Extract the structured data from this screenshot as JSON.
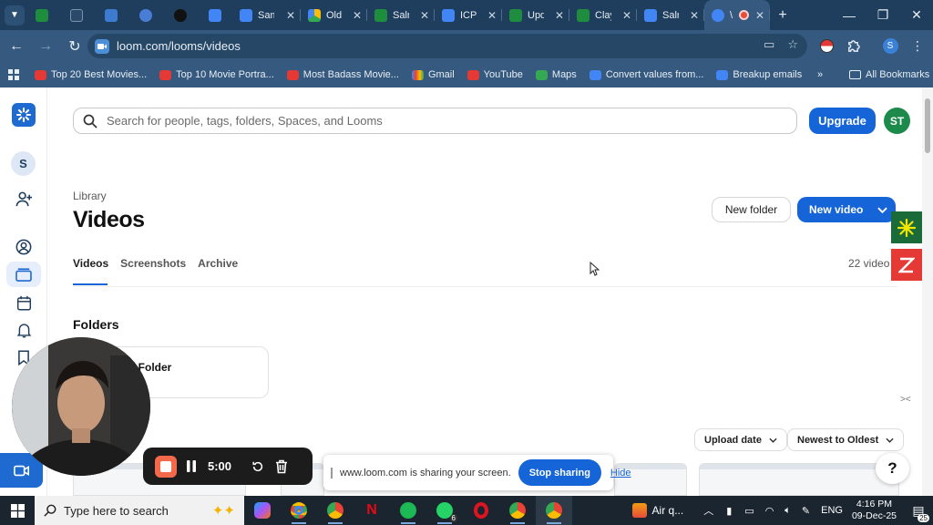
{
  "browser": {
    "tabs": [
      {
        "title": "Sam",
        "favicon_color": "#4285f4"
      },
      {
        "title": "Old",
        "favicon_color": "#34a853"
      },
      {
        "title": "Saln",
        "favicon_color": "#1e8e3e"
      },
      {
        "title": "ICP",
        "favicon_color": "#4285f4"
      },
      {
        "title": "Upd",
        "favicon_color": "#1e8e3e"
      },
      {
        "title": "Clay",
        "favicon_color": "#1e8e3e"
      },
      {
        "title": "Saln",
        "favicon_color": "#4285f4"
      },
      {
        "title": "\\",
        "favicon_color": "#4285f4"
      }
    ],
    "url": "loom.com/looms/videos",
    "bookmarks": [
      {
        "label": "Top 20 Best Movies...",
        "color": "#e53935"
      },
      {
        "label": "Top 10 Movie Portra...",
        "color": "#e53935"
      },
      {
        "label": "Most Badass Movie...",
        "color": "#e53935"
      },
      {
        "label": "Gmail",
        "color": "#ea4335"
      },
      {
        "label": "YouTube",
        "color": "#e53935"
      },
      {
        "label": "Maps",
        "color": "#34a853"
      },
      {
        "label": "Convert values from...",
        "color": "#4285f4"
      },
      {
        "label": "Breakup emails",
        "color": "#4285f4"
      }
    ],
    "more_bookmarks": "»",
    "all_bookmarks": "All Bookmarks"
  },
  "loom": {
    "workspace_initial": "S",
    "search_placeholder": "Search for people, tags, folders, Spaces, and Looms",
    "upgrade_label": "Upgrade",
    "user_initials": "ST",
    "breadcrumb": "Library",
    "title": "Videos",
    "new_folder_label": "New folder",
    "new_video_label": "New video",
    "tabs": [
      "Videos",
      "Screenshots",
      "Archive"
    ],
    "video_count": "22 video",
    "folders_heading": "Folders",
    "folder_name": "d Folder",
    "sort_by_label": "Upload date",
    "sort_order_label": "Newest to Oldest",
    "help_label": "?"
  },
  "recording": {
    "timer": "5:00",
    "share_text": "www.loom.com is sharing your screen.",
    "stop_sharing_label": "Stop sharing",
    "hide_label": "Hide"
  },
  "taskbar": {
    "search_placeholder": "Type here to search",
    "weather": "Air q...",
    "language": "ENG",
    "time": "4:16 PM",
    "date": "09-Dec-25",
    "whatsapp_badge": "6",
    "notification_count": "25"
  }
}
